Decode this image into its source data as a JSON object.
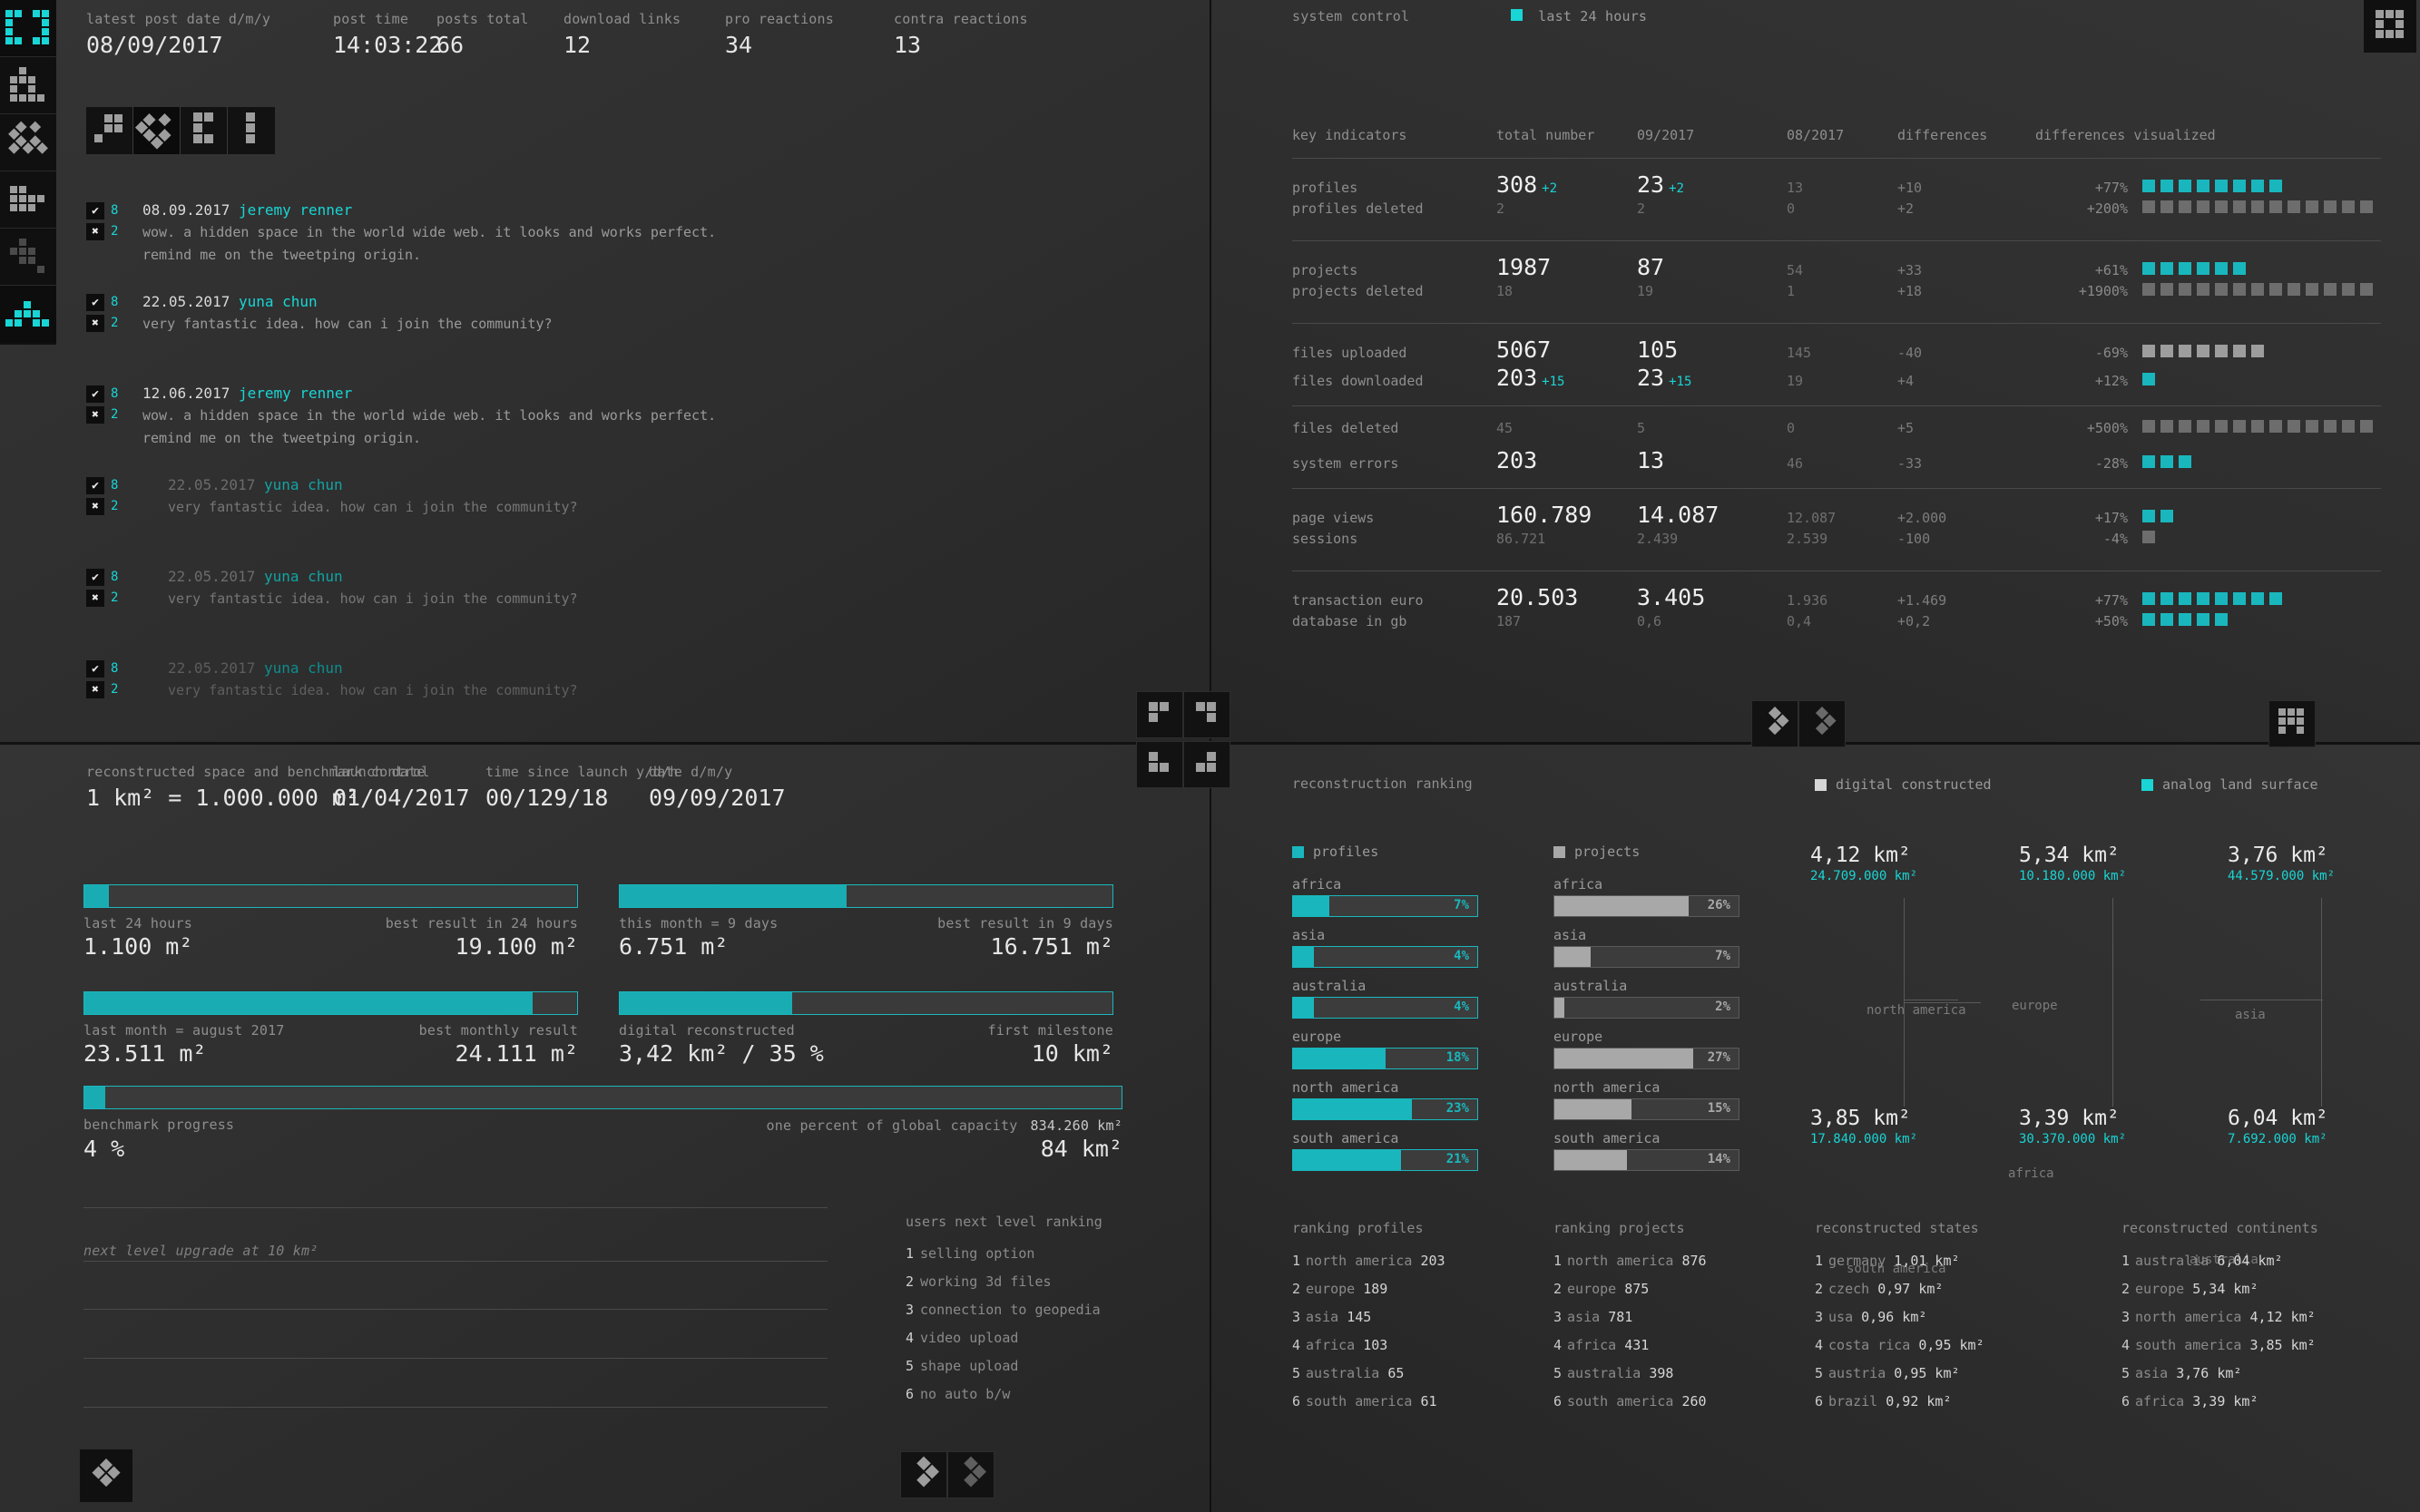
{
  "accent": "#19d5d5",
  "accent_bar": "#1aacb3",
  "grey_bar": "#a8a8a8",
  "sidebar": {
    "items": [
      {
        "name": "dashboard-icon",
        "selected": true
      },
      {
        "name": "layers-icon",
        "selected": false
      },
      {
        "name": "diamond-grid-icon",
        "selected": false
      },
      {
        "name": "blocks-icon",
        "selected": false
      },
      {
        "name": "steps-icon",
        "selected": false
      },
      {
        "name": "pyramid-icon",
        "selected": true
      }
    ]
  },
  "top_left": {
    "metrics": [
      {
        "label": "latest post date d/m/y",
        "value": "08/09/2017"
      },
      {
        "label": "post time",
        "value": "14:03:22"
      },
      {
        "label": "posts total",
        "value": "66"
      },
      {
        "label": "download links",
        "value": "12"
      },
      {
        "label": "pro reactions",
        "value": "34"
      },
      {
        "label": "contra reactions",
        "value": "13"
      }
    ],
    "view_buttons": [
      {
        "name": "view-squares-icon",
        "active": false
      },
      {
        "name": "view-diamonds-icon",
        "active": true
      },
      {
        "name": "view-bracket-icon",
        "active": false
      },
      {
        "name": "view-column-icon",
        "active": false
      }
    ],
    "posts": [
      {
        "up": "8",
        "down": "2",
        "date": "08.09.2017",
        "author": "jeremy renner",
        "line1": "wow. a hidden space in the world wide web. it looks and works perfect.",
        "line2": "remind me on the tweetping origin.",
        "has_badge": true,
        "fade": 0,
        "indent": false
      },
      {
        "up": "8",
        "down": "2",
        "date": "22.05.2017",
        "author": "yuna chun",
        "line1": "very fantastic idea. how can i join the community?",
        "line2": "",
        "has_badge": true,
        "fade": 0,
        "indent": false
      },
      {
        "up": "8",
        "down": "2",
        "date": "12.06.2017",
        "author": "jeremy renner",
        "line1": "wow. a hidden space in the world wide web. it looks and works perfect.",
        "line2": "remind me on the tweetping origin.",
        "has_badge": false,
        "fade": 0,
        "indent": false
      },
      {
        "up": "8",
        "down": "2",
        "date": "22.05.2017",
        "author": "yuna chun",
        "line1": "very fantastic idea. how can i join the community?",
        "line2": "",
        "has_badge": false,
        "fade": 1,
        "indent": true
      },
      {
        "up": "8",
        "down": "2",
        "date": "22.05.2017",
        "author": "yuna chun",
        "line1": "very fantastic idea. how can i join the community?",
        "line2": "",
        "has_badge": false,
        "fade": 1,
        "indent": true
      },
      {
        "up": "8",
        "down": "2",
        "date": "22.05.2017",
        "author": "yuna chun",
        "line1": "very fantastic idea. how can i join the community?",
        "line2": "",
        "has_badge": true,
        "fade": 2,
        "indent": true
      }
    ]
  },
  "system_control": {
    "title": "system control",
    "legend_label": "last 24 hours",
    "columns": [
      "key indicators",
      "total number",
      "09/2017",
      "08/2017",
      "differences",
      "differences visualized"
    ],
    "groups": [
      [
        {
          "name": "profiles",
          "total": "308",
          "total_delta": "+2",
          "m1": "23",
          "m1_delta": "+2",
          "m2": "13",
          "diff": "+10",
          "pct": "+77%",
          "blocks": 8,
          "block_color": "on",
          "emph": true
        },
        {
          "name": "profiles deleted",
          "total": "2",
          "total_delta": "",
          "m1": "2",
          "m1_delta": "",
          "m2": "0",
          "diff": "+2",
          "pct": "+200%",
          "blocks": 13,
          "block_color": "off",
          "emph": false
        }
      ],
      [
        {
          "name": "projects",
          "total": "1987",
          "total_delta": "",
          "m1": "87",
          "m1_delta": "",
          "m2": "54",
          "diff": "+33",
          "pct": "+61%",
          "blocks": 6,
          "block_color": "on",
          "emph": true
        },
        {
          "name": "projects deleted",
          "total": "18",
          "total_delta": "",
          "m1": "19",
          "m1_delta": "",
          "m2": "1",
          "diff": "+18",
          "pct": "+1900%",
          "blocks": 13,
          "block_color": "off",
          "emph": false
        }
      ],
      [
        {
          "name": "files uploaded",
          "total": "5067",
          "total_delta": "",
          "m1": "105",
          "m1_delta": "",
          "m2": "145",
          "diff": "-40",
          "pct": "-69%",
          "blocks": 7,
          "block_color": "off",
          "emph": true
        },
        {
          "name": "files downloaded",
          "total": "203",
          "total_delta": "+15",
          "m1": "23",
          "m1_delta": "+15",
          "m2": "19",
          "diff": "+4",
          "pct": "+12%",
          "blocks": 1,
          "block_color": "on",
          "emph": true
        }
      ],
      [
        {
          "name": "files deleted",
          "total": "45",
          "total_delta": "",
          "m1": "5",
          "m1_delta": "",
          "m2": "0",
          "diff": "+5",
          "pct": "+500%",
          "blocks": 13,
          "block_color": "off",
          "emph": false
        },
        {
          "name": "system errors",
          "total": "203",
          "total_delta": "",
          "m1": "13",
          "m1_delta": "",
          "m2": "46",
          "diff": "-33",
          "pct": "-28%",
          "blocks": 3,
          "block_color": "on",
          "emph": true
        }
      ],
      [
        {
          "name": "page views",
          "total": "160.789",
          "total_delta": "",
          "m1": "14.087",
          "m1_delta": "",
          "m2": "12.087",
          "diff": "+2.000",
          "pct": "+17%",
          "blocks": 2,
          "block_color": "on",
          "emph": true
        },
        {
          "name": "sessions",
          "total": "86.721",
          "total_delta": "",
          "m1": "2.439",
          "m1_delta": "",
          "m2": "2.539",
          "diff": "-100",
          "pct": "-4%",
          "blocks": 1,
          "block_color": "off",
          "emph": false
        }
      ],
      [
        {
          "name": "transaction euro",
          "total": "20.503",
          "total_delta": "",
          "m1": "3.405",
          "m1_delta": "",
          "m2": "1.936",
          "diff": "+1.469",
          "pct": "+77%",
          "blocks": 8,
          "block_color": "on",
          "emph": true
        },
        {
          "name": "database in gb",
          "total": "187",
          "total_delta": "",
          "m1": "0,6",
          "m1_delta": "",
          "m2": "0,4",
          "diff": "+0,2",
          "pct": "+50%",
          "blocks": 5,
          "block_color": "on",
          "emph": false
        }
      ]
    ]
  },
  "bottom_left": {
    "metrics": [
      {
        "label": "reconstructed space and benchmark control",
        "value": "1 km² = 1.000.000 m²"
      },
      {
        "label": "launch date",
        "value": "01/04/2017"
      },
      {
        "label": "time since launch y/d/h",
        "value": "00/129/18"
      },
      {
        "label": "date d/m/y",
        "value": "09/09/2017"
      }
    ],
    "bars": [
      {
        "left_label": "last 24 hours",
        "left_value": "1.100 m²",
        "right_label": "best result in 24 hours",
        "right_value": "19.100 m²",
        "pct": 5
      },
      {
        "left_label": "this month = 9 days",
        "left_value": "6.751 m²",
        "right_label": "best result in 9 days",
        "right_value": "16.751 m²",
        "pct": 46
      },
      {
        "left_label": "last month = august 2017",
        "left_value": "23.511 m²",
        "right_label": "best monthly result",
        "right_value": "24.111 m²",
        "pct": 91
      },
      {
        "left_label": "digital reconstructed",
        "left_value": "3,42 km² / 35 %",
        "right_label": "first milestone",
        "right_value": "10 km²",
        "pct": 35
      }
    ],
    "progress": {
      "pct_fill": 2,
      "left_label": "benchmark progress",
      "left_value": "4 %",
      "right_label": "one percent of global capacity",
      "right_value_top": "834.260 km²",
      "right_value": "84 km²"
    },
    "next_level_note": "next level upgrade at 10 km²",
    "next_level_ranking": {
      "title": "users next level ranking",
      "items": [
        "selling option",
        "working 3d files",
        "connection to geopedia",
        "video upload",
        "shape upload",
        "no auto b/w"
      ]
    }
  },
  "bottom_right": {
    "title": "reconstruction ranking",
    "legend": [
      {
        "label": "digital constructed",
        "color": "#d6d6d6"
      },
      {
        "label": "analog land surface",
        "color": "#19d5d5"
      }
    ],
    "profiles": {
      "legend": "profiles",
      "rows": [
        {
          "name": "africa",
          "pct": 7
        },
        {
          "name": "asia",
          "pct": 4
        },
        {
          "name": "australia",
          "pct": 4
        },
        {
          "name": "europe",
          "pct": 18
        },
        {
          "name": "north america",
          "pct": 23
        },
        {
          "name": "south america",
          "pct": 21
        }
      ]
    },
    "projects": {
      "legend": "projects",
      "rows": [
        {
          "name": "africa",
          "pct": 26
        },
        {
          "name": "asia",
          "pct": 7
        },
        {
          "name": "australia",
          "pct": 2
        },
        {
          "name": "europe",
          "pct": 27
        },
        {
          "name": "north america",
          "pct": 15
        },
        {
          "name": "south america",
          "pct": 14
        }
      ]
    },
    "continents": [
      {
        "name": "north america",
        "digital": "4,12 km²",
        "analog": "24.709.000 km²"
      },
      {
        "name": "europe",
        "digital": "5,34 km²",
        "analog": "10.180.000 km²"
      },
      {
        "name": "asia",
        "digital": "3,76 km²",
        "analog": "44.579.000 km²"
      },
      {
        "name": "south america",
        "digital": "3,85 km²",
        "analog": "17.840.000 km²"
      },
      {
        "name": "africa",
        "digital": "3,39 km²",
        "analog": "30.370.000 km²"
      },
      {
        "name": "australia",
        "digital": "6,04 km²",
        "analog": "7.692.000 km²"
      }
    ],
    "lists": [
      {
        "title": "ranking profiles",
        "items": [
          {
            "name": "north america",
            "value": "203"
          },
          {
            "name": "europe",
            "value": "189"
          },
          {
            "name": "asia",
            "value": "145"
          },
          {
            "name": "africa",
            "value": "103"
          },
          {
            "name": "australia",
            "value": "65"
          },
          {
            "name": "south america",
            "value": "61"
          }
        ]
      },
      {
        "title": "ranking projects",
        "items": [
          {
            "name": "north america",
            "value": "876"
          },
          {
            "name": "europe",
            "value": "875"
          },
          {
            "name": "asia",
            "value": "781"
          },
          {
            "name": "africa",
            "value": "431"
          },
          {
            "name": "australia",
            "value": "398"
          },
          {
            "name": "south america",
            "value": "260"
          }
        ]
      },
      {
        "title": "reconstructed states",
        "items": [
          {
            "name": "germany",
            "value": "1,01 km²"
          },
          {
            "name": "czech",
            "value": "0,97 km²"
          },
          {
            "name": "usa",
            "value": "0,96 km²"
          },
          {
            "name": "costa rica",
            "value": "0,95 km²"
          },
          {
            "name": "austria",
            "value": "0,95 km²"
          },
          {
            "name": "brazil",
            "value": "0,92 km²"
          }
        ]
      },
      {
        "title": "reconstructed continents",
        "items": [
          {
            "name": "australia",
            "value": "6,04 km²"
          },
          {
            "name": "europe",
            "value": "5,34 km²"
          },
          {
            "name": "north america",
            "value": "4,12 km²"
          },
          {
            "name": "south america",
            "value": "3,85 km²"
          },
          {
            "name": "asia",
            "value": "3,76 km²"
          },
          {
            "name": "africa",
            "value": "3,39 km²"
          }
        ]
      }
    ]
  },
  "chart_data": {
    "type": "bar",
    "title": "reconstruction ranking",
    "series": [
      {
        "name": "profiles",
        "color": "#19d5d5",
        "categories": [
          "africa",
          "asia",
          "australia",
          "europe",
          "north america",
          "south america"
        ],
        "values": [
          7,
          4,
          4,
          18,
          23,
          21
        ]
      },
      {
        "name": "projects",
        "color": "#a8a8a8",
        "categories": [
          "africa",
          "asia",
          "australia",
          "europe",
          "north america",
          "south america"
        ],
        "values": [
          26,
          7,
          2,
          27,
          15,
          14
        ]
      }
    ],
    "ylabel": "percent",
    "ylim": [
      0,
      100
    ],
    "grid": false,
    "legend": "top"
  }
}
